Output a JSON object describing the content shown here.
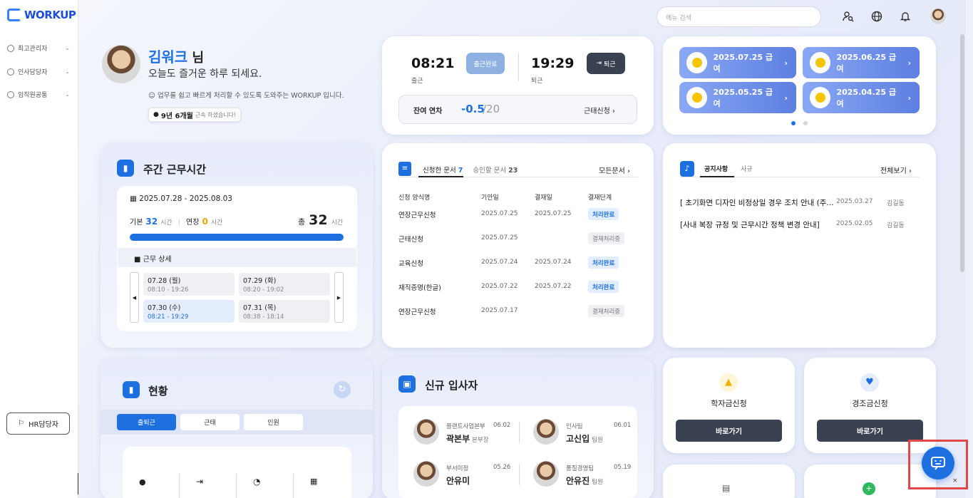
{
  "app": {
    "logo": "WORKUP"
  },
  "sidebar": {
    "items": [
      {
        "label": "최고관리자"
      },
      {
        "label": "인사담당자"
      },
      {
        "label": "임직원공통"
      }
    ],
    "hr_button": "HR담당자",
    "collapse": "›"
  },
  "header": {
    "search_placeholder": "메뉴 검색"
  },
  "profile": {
    "name": "김워크",
    "suffix": " 님",
    "greeting": "오늘도 즐거운 하루 되세요.",
    "description": "업무를 쉽고 빠르게 처리할 수 있도록 도와주는 WORKUP 입니다.",
    "tenure": "9년 6개월",
    "tenure_suffix": "근속 하셨습니다!"
  },
  "attendance": {
    "in_time": "08:21",
    "in_label": "출근",
    "in_button": "출근완료",
    "out_time": "19:29",
    "out_label": "퇴근",
    "out_button": "퇴근",
    "leave_label": "잔여 연차",
    "leave_value": "-0.5",
    "leave_total": "/20",
    "leave_request": "근태신청"
  },
  "salary": [
    {
      "label": "2025.07.25 급여"
    },
    {
      "label": "2025.06.25 급여"
    },
    {
      "label": "2025.05.25 급여"
    },
    {
      "label": "2025.04.25 급여"
    }
  ],
  "weekly": {
    "title": "주간 근무시간",
    "range": "2025.07.28 - 2025.08.03",
    "basic_label": "기본",
    "basic_value": "32",
    "ot_label": "연장",
    "ot_value": "0",
    "unit": "시간",
    "total_label": "총",
    "total_value": "32",
    "progress": 1.0,
    "detail_label": "근무 상세",
    "days": [
      {
        "day": "07.28 (월)",
        "time": "08:10 - 19:26"
      },
      {
        "day": "07.29 (화)",
        "time": "08:20 - 19:02"
      },
      {
        "day": "07.30 (수)",
        "time": "08:21 - 19:29"
      },
      {
        "day": "07.31 (목)",
        "time": "08:38 - 18:14"
      }
    ]
  },
  "docs": {
    "tab1": "신청한 문서",
    "tab1_count": "7",
    "tab2": "승인할 문서",
    "tab2_count": "23",
    "all": "모든문서",
    "headers": [
      "신청 양식명",
      "기안일",
      "결재일",
      "결재단계"
    ],
    "rows": [
      {
        "name": "연장근무신청",
        "draft": "2025.07.25",
        "approve": "2025.07.25",
        "status": "처리완료"
      },
      {
        "name": "근태신청",
        "draft": "2025.07.25",
        "approve": "",
        "status": "결재처리중"
      },
      {
        "name": "교육신청",
        "draft": "2025.07.24",
        "approve": "2025.07.24",
        "status": "처리완료"
      },
      {
        "name": "재직증명(한글)",
        "draft": "2025.07.22",
        "approve": "2025.07.22",
        "status": "처리완료"
      },
      {
        "name": "연장근무신청",
        "draft": "2025.07.17",
        "approve": "",
        "status": "결재처리중"
      }
    ]
  },
  "notice": {
    "tab1": "공지사항",
    "tab2": "사규",
    "all": "전체보기",
    "items": [
      {
        "title": "[ 초기화면 디자인 비정상일 경우 조치 안내 (주...",
        "date": "2025.03.27",
        "author": "김길동"
      },
      {
        "title": "[사내 복장 규정 및 근무시간 정책 변경 안내]",
        "date": "2025.02.05",
        "author": "김길동"
      }
    ]
  },
  "status": {
    "title": "현황",
    "tabs": [
      "출퇴근",
      "근태",
      "인원"
    ]
  },
  "newhires": {
    "title": "신규 입사자",
    "people": [
      {
        "team": "플랜트사업본부",
        "date": "06.02",
        "name": "곽본부",
        "role": "본부장"
      },
      {
        "team": "인사팀",
        "date": "06.01",
        "name": "고신입",
        "role": "팀원"
      },
      {
        "team": "부서미정",
        "date": "05.26",
        "name": "안유미",
        "role": ""
      },
      {
        "team": "품질경영팀",
        "date": "05.19",
        "name": "안유진",
        "role": "팀원"
      }
    ]
  },
  "quick": [
    {
      "title": "학자금신청",
      "button": "바로가기"
    },
    {
      "title": "경조금신청",
      "button": "바로가기"
    }
  ],
  "colors": {
    "accent": "#1e6fe0",
    "dark_button": "#3a4150",
    "highlight": "#e04848"
  }
}
